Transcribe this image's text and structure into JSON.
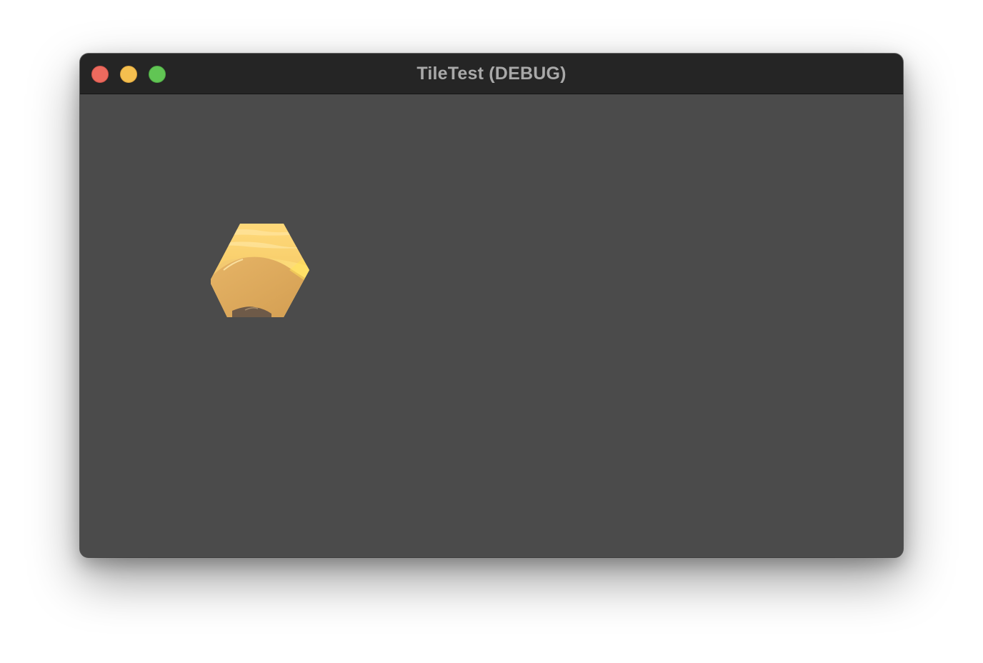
{
  "window": {
    "title": "TileTest (DEBUG)",
    "controls": {
      "close_icon": "close-icon",
      "minimize_icon": "minimize-icon",
      "zoom_icon": "zoom-icon"
    }
  },
  "colors": {
    "titlebar": "#252525",
    "content_background": "#4b4b4b",
    "title_text": "#a9a9a9",
    "close": "#ec6a5e",
    "minimize": "#f4bf4f",
    "zoom": "#61c554"
  },
  "content": {
    "tiles": [
      {
        "icon": "desert-dune-hex-tile"
      }
    ]
  }
}
